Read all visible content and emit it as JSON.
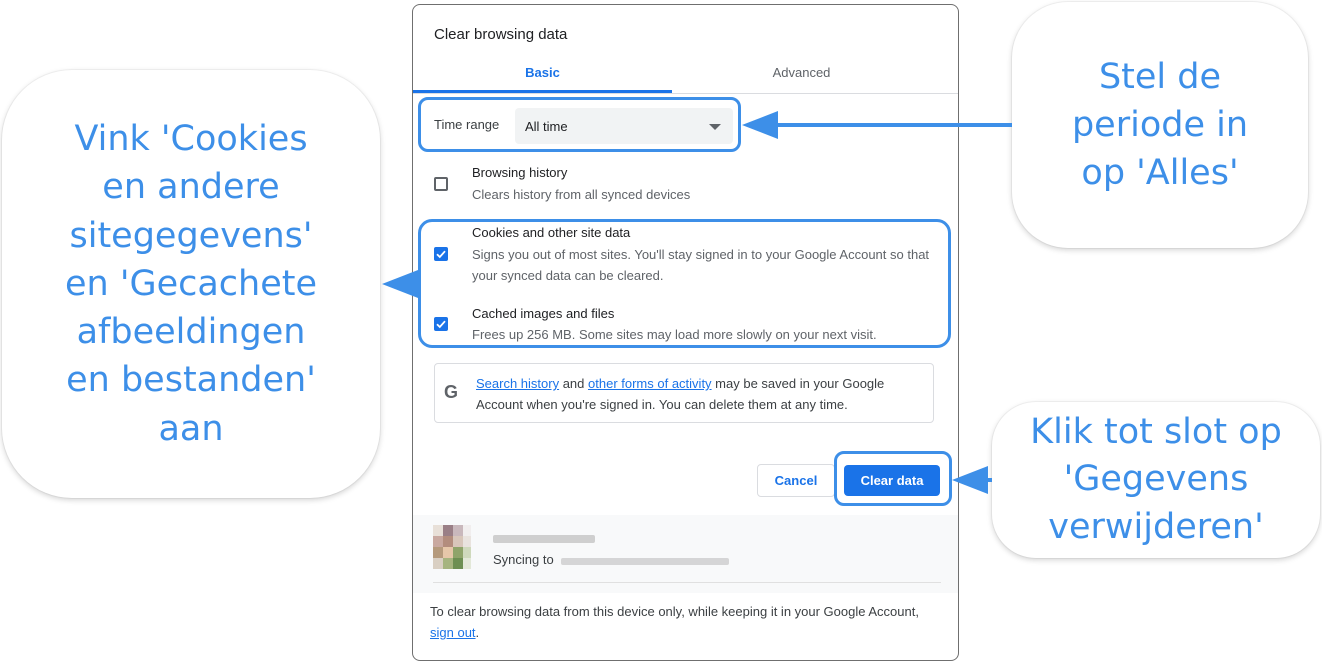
{
  "callouts": {
    "left": "Vink 'Cookies\nen andere\nsitegegevens'\nen 'Gecachete\nafbeeldingen\nen bestanden'\naan",
    "top_right": "Stel de\nperiode in\nop 'Alles'",
    "bottom_right": "Klik tot slot op\n'Gegevens\nverwijderen'"
  },
  "dialog": {
    "title": "Clear browsing data",
    "tabs": [
      {
        "label": "Basic",
        "active": true
      },
      {
        "label": "Advanced",
        "active": false
      }
    ],
    "time_range": {
      "label": "Time range",
      "value": "All time"
    },
    "options": [
      {
        "title": "Browsing history",
        "description": "Clears history from all synced devices",
        "checked": false
      },
      {
        "title": "Cookies and other site data",
        "description": "Signs you out of most sites. You'll stay signed in to your Google Account so that your synced data can be cleared.",
        "checked": true
      },
      {
        "title": "Cached images and files",
        "description": "Frees up 256 MB. Some sites may load more slowly on your next visit.",
        "checked": true
      }
    ],
    "info": {
      "icon": "google-g-icon",
      "link1": "Search history",
      "and": " and ",
      "link2": "other forms of activity",
      "rest": " may be saved in your Google Account when you're signed in. You can delete them at any time."
    },
    "buttons": {
      "cancel": "Cancel",
      "clear": "Clear data"
    },
    "account": {
      "syncing_label": "Syncing to"
    },
    "footer": {
      "text": "To clear browsing data from this device only, while keeping it in your Google Account, ",
      "link": "sign out",
      "end": "."
    }
  },
  "colors": {
    "accent": "#1a73e8",
    "annotation": "#3d8fe8"
  }
}
